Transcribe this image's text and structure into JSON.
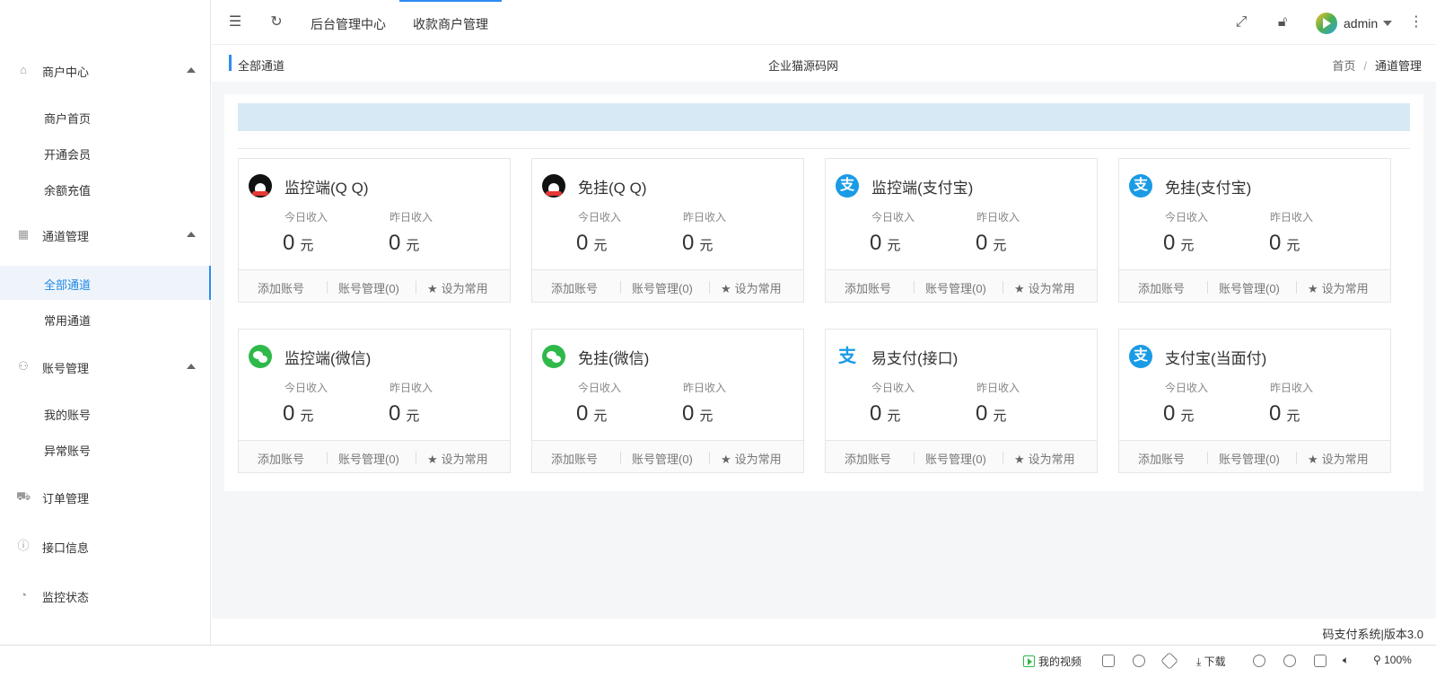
{
  "sidebar": {
    "groups": [
      {
        "label": "商户中心",
        "icon": "home-icon",
        "items": [
          "商户首页",
          "开通会员",
          "余额充值"
        ]
      },
      {
        "label": "通道管理",
        "icon": "apps-icon",
        "items": [
          "全部通道",
          "常用通道"
        ]
      },
      {
        "label": "账号管理",
        "icon": "user-icon",
        "items": [
          "我的账号",
          "异常账号"
        ]
      }
    ],
    "singles": [
      {
        "label": "订单管理",
        "icon": "cart-icon"
      },
      {
        "label": "接口信息",
        "icon": "info-icon"
      },
      {
        "label": "监控状态",
        "icon": "dashboard-icon"
      }
    ],
    "active_item": "全部通道"
  },
  "header": {
    "tabs": [
      "后台管理中心",
      "收款商户管理"
    ],
    "active_tab": "收款商户管理",
    "user": "admin"
  },
  "breadcrumb": {
    "title": "全部通道",
    "center": "企业猫源码网",
    "home": "首页",
    "sep": "/",
    "current": "通道管理"
  },
  "card_labels": {
    "today": "今日收入",
    "yesterday": "昨日收入",
    "unit": "元",
    "add": "添加账号",
    "manage": "账号管理(0)",
    "favorite": "设为常用"
  },
  "channels": [
    {
      "title": "监控端(Q Q)",
      "icon": "qq-icon",
      "today": "0",
      "yesterday": "0"
    },
    {
      "title": "免挂(Q Q)",
      "icon": "qq-icon",
      "today": "0",
      "yesterday": "0"
    },
    {
      "title": "监控端(支付宝)",
      "icon": "alipay-icon",
      "today": "0",
      "yesterday": "0"
    },
    {
      "title": "免挂(支付宝)",
      "icon": "alipay-icon",
      "today": "0",
      "yesterday": "0"
    },
    {
      "title": "监控端(微信)",
      "icon": "wechat-icon",
      "today": "0",
      "yesterday": "0"
    },
    {
      "title": "免挂(微信)",
      "icon": "wechat-icon",
      "today": "0",
      "yesterday": "0"
    },
    {
      "title": "易支付(接口)",
      "icon": "epay-icon",
      "today": "0",
      "yesterday": "0"
    },
    {
      "title": "支付宝(当面付)",
      "icon": "alipay-icon",
      "today": "0",
      "yesterday": "0"
    }
  ],
  "footer": {
    "text": "码支付系统|版本3.0"
  },
  "statusbar": {
    "my_video": "我的视频",
    "download": "下载",
    "zoom": "100%"
  },
  "colors": {
    "accent": "#2d8cf0",
    "notice_bg": "#d7e9f5",
    "alipay": "#1a9be6",
    "wechat": "#2fb94a"
  }
}
